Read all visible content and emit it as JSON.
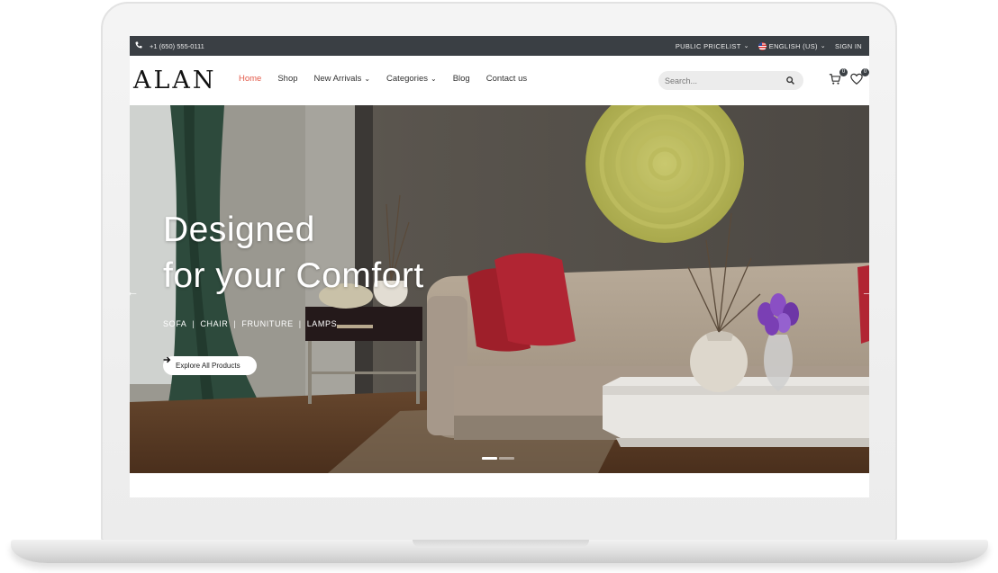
{
  "topbar": {
    "phone_icon": "phone-icon",
    "phone": "+1 (650) 555-0111",
    "pricelist": "PUBLIC PRICELIST",
    "language": "ENGLISH (US)",
    "signin": "SIGN IN"
  },
  "header": {
    "logo": "ALAN",
    "nav": [
      {
        "label": "Home",
        "active": true
      },
      {
        "label": "Shop"
      },
      {
        "label": "New Arrivals",
        "dropdown": true
      },
      {
        "label": "Categories",
        "dropdown": true
      },
      {
        "label": "Blog"
      },
      {
        "label": "Contact us"
      }
    ],
    "search_placeholder": "Search...",
    "cart_count": "0",
    "wishlist_count": "0"
  },
  "hero": {
    "title_line1": "Designed",
    "title_line2": "for your Comfort",
    "categories": [
      "SOFA",
      "CHAIR",
      "FRUNITURE",
      "LAMPS"
    ],
    "cta": "Explore All Products",
    "slide_count": 2,
    "active_slide": 0
  },
  "colors": {
    "accent": "#e35a4a",
    "topbar": "#3a3f44"
  }
}
